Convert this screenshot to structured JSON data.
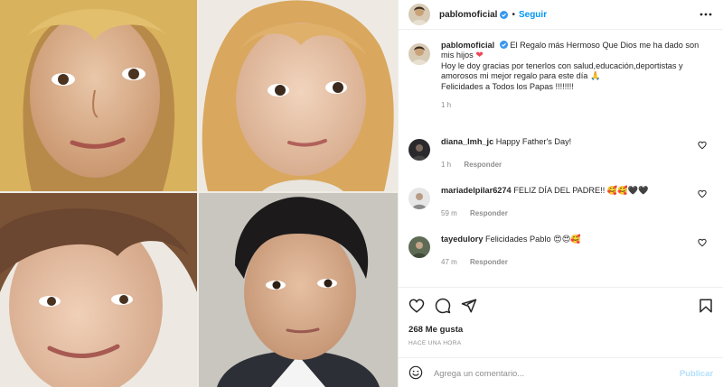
{
  "post": {
    "author": {
      "username": "pablomoficial",
      "verified": true,
      "follow_label": "Seguir",
      "separator": "•"
    },
    "caption": {
      "username": "pablomoficial",
      "line1": "El Regalo más Hermoso Que Dios me ha dado son mis hijos",
      "line2": "Hoy le doy gracias por tenerlos con salud,educación,deportistas y amorosos mi mejor regalo para este día",
      "line3": "Felicidades a Todos los Papas !!!!!!!!",
      "heart_emoji": "❤",
      "pray_emoji": "🙏",
      "time": "1 h"
    },
    "comments": [
      {
        "username": "diana_lmh_jc",
        "text": "Happy Father's Day!",
        "emojis": "",
        "time": "1 h",
        "reply_label": "Responder"
      },
      {
        "username": "mariadelpilar6274",
        "text": "FELIZ DÍA DEL PADRE!!",
        "emojis": "🥰🥰🖤🖤",
        "time": "59 m",
        "reply_label": "Responder"
      },
      {
        "username": "tayedulory",
        "text": "Felicidades Pablo",
        "emojis": "😍😍🥰",
        "time": "47 m",
        "reply_label": "Responder"
      }
    ],
    "likes_label": "268 Me gusta",
    "posted_ago": "HACE UNA HORA",
    "comment_input": {
      "placeholder": "Agrega un comentario...",
      "value": ""
    },
    "publish_label": "Publicar"
  },
  "icons": {
    "more": "more-options-icon",
    "like": "heart-outline-icon",
    "comment": "comment-bubble-icon",
    "share": "paper-plane-icon",
    "save": "bookmark-icon",
    "emoji": "smiley-icon",
    "verified": "verified-badge-icon"
  },
  "colors": {
    "follow": "#0095f6",
    "verified": "#3897f0",
    "heart": "#ed4956",
    "muted": "#8e8e8e",
    "publish_disabled": "#b2dffc"
  }
}
